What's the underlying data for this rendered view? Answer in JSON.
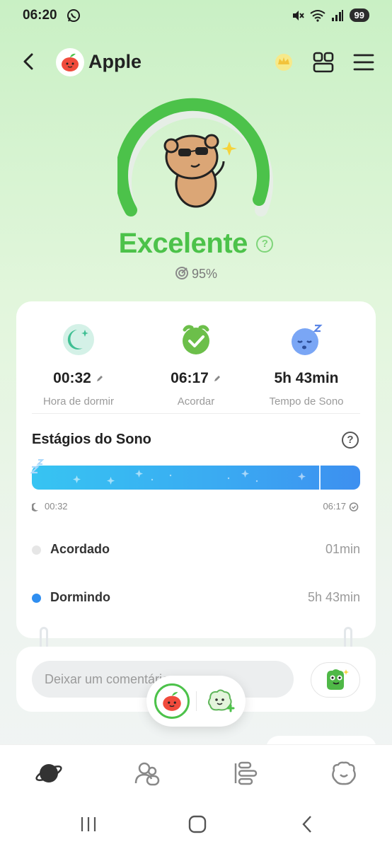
{
  "status": {
    "time": "06:20",
    "battery": "99"
  },
  "header": {
    "title": "Apple"
  },
  "score": {
    "label": "Excelente",
    "percent": "95%",
    "help": "?"
  },
  "metrics": [
    {
      "value": "00:32",
      "label": "Hora de dormir",
      "icon": "moon-stars-icon"
    },
    {
      "value": "06:17",
      "label": "Acordar",
      "icon": "alarm-clock-check-icon"
    },
    {
      "value": "5h 43min",
      "label": "Tempo de Sono",
      "icon": "sleeping-face-icon"
    }
  ],
  "stages": {
    "title": "Estágios do Sono",
    "help": "?",
    "start_time": "00:32",
    "end_time": "06:17",
    "items": [
      {
        "name": "Acordado",
        "value": "01min",
        "color": "#e6e6e6"
      },
      {
        "name": "Dormindo",
        "value": "5h 43min",
        "color": "#2f8ef0"
      }
    ]
  },
  "comment": {
    "placeholder": "Deixar um comentário"
  },
  "tabs": [
    "planet-icon",
    "friends-icon",
    "list-icon",
    "bear-face-icon"
  ],
  "colors": {
    "accent": "#4cc24a",
    "bar": "#3aa9f2"
  }
}
